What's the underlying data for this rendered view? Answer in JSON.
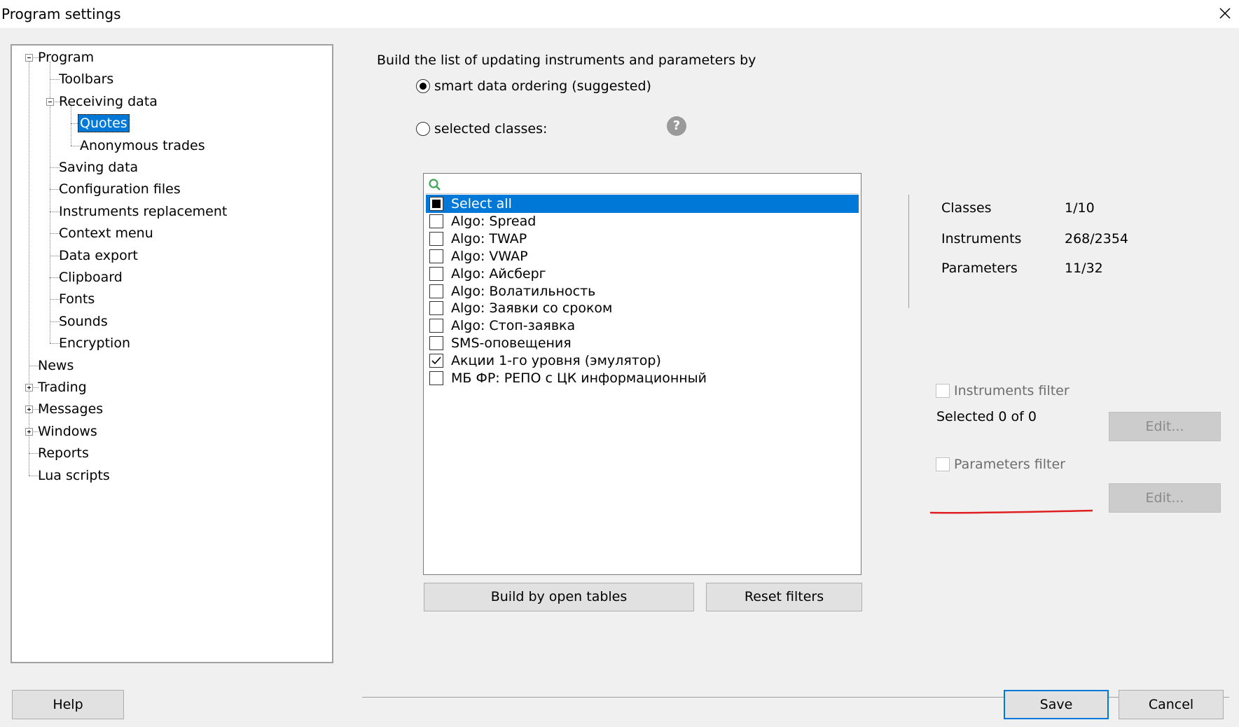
{
  "window": {
    "title": "Program settings",
    "close_icon": "close-icon"
  },
  "tree": {
    "items": [
      {
        "label": "Program",
        "expander": "minus"
      },
      {
        "label": "Toolbars"
      },
      {
        "label": "Receiving data",
        "expander": "minus"
      },
      {
        "label": "Quotes",
        "selected": true
      },
      {
        "label": "Anonymous trades"
      },
      {
        "label": "Saving data"
      },
      {
        "label": "Configuration files"
      },
      {
        "label": "Instruments replacement"
      },
      {
        "label": "Context menu"
      },
      {
        "label": "Data export"
      },
      {
        "label": "Clipboard"
      },
      {
        "label": "Fonts"
      },
      {
        "label": "Sounds"
      },
      {
        "label": "Encryption"
      },
      {
        "label": "News"
      },
      {
        "label": "Trading",
        "expander": "plus"
      },
      {
        "label": "Messages",
        "expander": "plus"
      },
      {
        "label": "Windows",
        "expander": "plus"
      },
      {
        "label": "Reports"
      },
      {
        "label": "Lua scripts"
      }
    ]
  },
  "settings": {
    "heading": "Build the list of updating instruments and parameters by",
    "option_smart": {
      "label": "smart data ordering (suggested)",
      "checked": true
    },
    "option_selected": {
      "label": "selected classes:",
      "checked": false
    },
    "help_icon": "question-icon",
    "search": {
      "value": "",
      "placeholder": ""
    },
    "classes": [
      {
        "label": "Select all",
        "state": "indeterminate",
        "selected": true
      },
      {
        "label": "Algo: Spread",
        "state": "unchecked"
      },
      {
        "label": "Algo: TWAP",
        "state": "unchecked"
      },
      {
        "label": "Algo: VWAP",
        "state": "unchecked"
      },
      {
        "label": "Algo: Айсберг",
        "state": "unchecked"
      },
      {
        "label": "Algo: Волатильность",
        "state": "unchecked"
      },
      {
        "label": "Algo: Заявки со сроком",
        "state": "unchecked"
      },
      {
        "label": "Algo: Стоп-заявка",
        "state": "unchecked"
      },
      {
        "label": "SMS-оповещения",
        "state": "unchecked"
      },
      {
        "label": "Акции 1-го уровня (эмулятор)",
        "state": "checked"
      },
      {
        "label": "МБ ФР: РЕПО с ЦК информационный",
        "state": "unchecked"
      }
    ],
    "build_button": "Build by open tables",
    "reset_button": "Reset filters"
  },
  "stats": {
    "classes_label": "Classes",
    "classes_value": "1/10",
    "instruments_label": "Instruments",
    "instruments_value": "268/2354",
    "parameters_label": "Parameters",
    "parameters_value": "11/32"
  },
  "filters": {
    "instruments_filter": {
      "label": "Instruments filter",
      "checked": false,
      "enabled": false
    },
    "selected_text": "Selected 0 of 0",
    "edit_instruments": "Edit...",
    "parameters_filter": {
      "label": "Parameters filter",
      "checked": false,
      "enabled": false
    },
    "edit_parameters": "Edit..."
  },
  "footer": {
    "help": "Help",
    "save": "Save",
    "cancel": "Cancel"
  },
  "colors": {
    "selection": "#0078d7",
    "dialog_bg": "#f0f0f0",
    "annotation": "#e02020",
    "search_icon": "#3aa856"
  }
}
